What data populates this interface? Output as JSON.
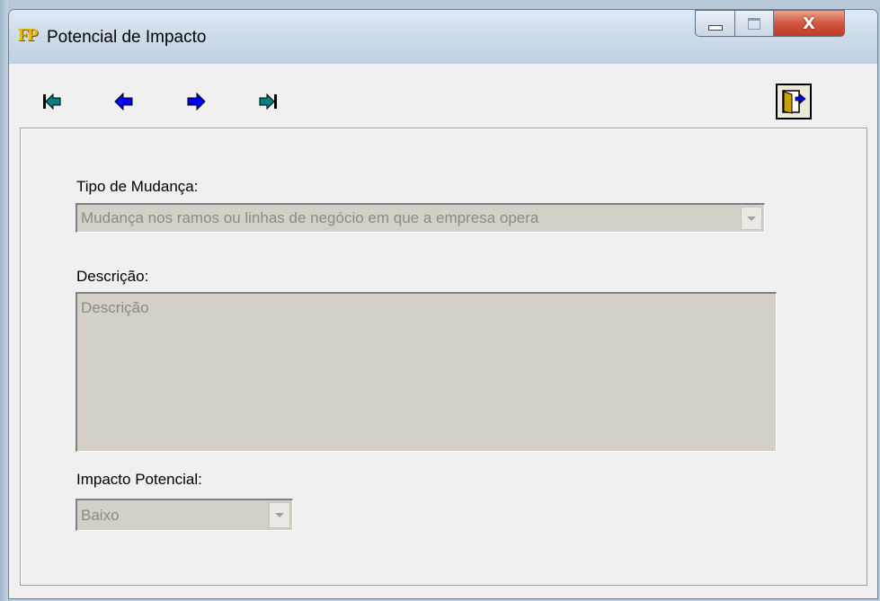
{
  "window": {
    "title": "Potencial de Impacto",
    "app_icon_text": "FP",
    "close_glyph": "X"
  },
  "toolbar": {
    "buttons": [
      {
        "name": "first-record",
        "icon": "arrow-first-icon"
      },
      {
        "name": "previous-record",
        "icon": "arrow-left-icon"
      },
      {
        "name": "next-record",
        "icon": "arrow-right-icon"
      },
      {
        "name": "last-record",
        "icon": "arrow-last-icon"
      }
    ],
    "exit_icon": "exit-door-icon"
  },
  "form": {
    "tipo_label": "Tipo de Mudança:",
    "tipo_value": "Mudança nos ramos ou linhas de negócio em que a empresa opera",
    "descricao_label": "Descrição:",
    "descricao_placeholder": "Descrição",
    "impacto_label": "Impacto Potencial:",
    "impacto_value": "Baixo"
  },
  "colors": {
    "nav_teal": "#008080",
    "nav_blue": "#0000ff",
    "disabled_field": "#d4d0c8",
    "disabled_text": "#8a8a8a"
  }
}
